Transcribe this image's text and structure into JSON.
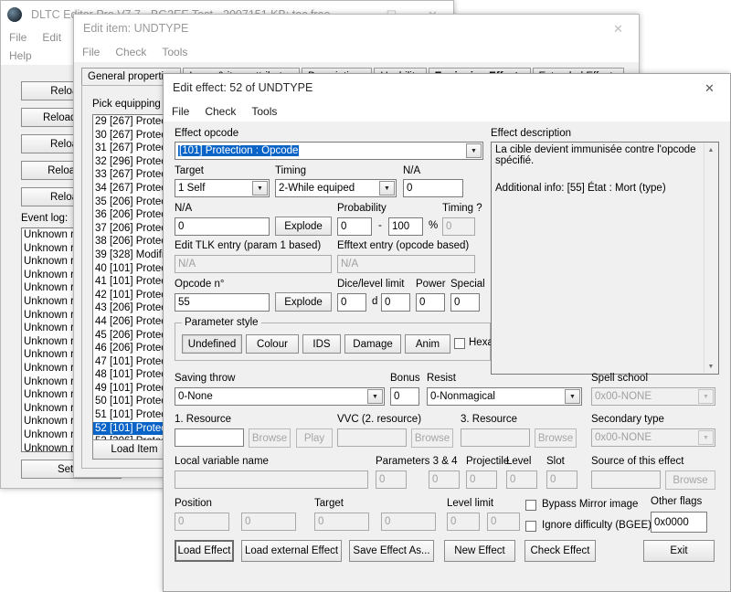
{
  "main_window": {
    "title": "DLTC Editor Pro V7.7 - BG2EE Test - 2007151 KB: toc free",
    "minimize": "—",
    "maximize": "☐",
    "close": "✕",
    "menus": [
      "File",
      "Edit",
      "S",
      "Help"
    ],
    "buttons": [
      "Reload c",
      "Reload gam",
      "Reload d",
      "Reload va",
      "Reload e"
    ],
    "event_log_label": "Event log:",
    "event_log_entries": [
      "Unknown re",
      "Unknown re",
      "Unknown re",
      "Unknown re",
      "Unknown re",
      "Unknown re",
      "Unknown re",
      "Unknown re",
      "Unknown re",
      "Unknown re",
      "Unknown re",
      "Unknown re",
      "Unknown re",
      "Unknown re",
      "Unknown re",
      "Unknown re",
      "Unknown re"
    ],
    "setup_button": "Setup"
  },
  "item_window": {
    "title": "Edit item: UNDTYPE",
    "close": "✕",
    "menus": [
      "File",
      "Check",
      "Tools"
    ],
    "tabs": [
      "General properties",
      "Icons & item attributes",
      "Descriptions",
      "Usability",
      "Equipping Effects",
      "Extended Effects"
    ],
    "active_tab": "Equipping Effects",
    "pick_label": "Pick equipping e",
    "effects": [
      {
        "text": "29 [267] Protec",
        "selected": false
      },
      {
        "text": "30 [267] Protec",
        "selected": false
      },
      {
        "text": "31 [267] Protec",
        "selected": false
      },
      {
        "text": "32 [296] Protec",
        "selected": false
      },
      {
        "text": "33 [267] Protec",
        "selected": false
      },
      {
        "text": "34 [267] Protec",
        "selected": false
      },
      {
        "text": "35 [206] Protec",
        "selected": false
      },
      {
        "text": "36 [206] Protec",
        "selected": false
      },
      {
        "text": "37 [206] Protec",
        "selected": false
      },
      {
        "text": "38 [206] Protec",
        "selected": false
      },
      {
        "text": "39 [328] Modific",
        "selected": false
      },
      {
        "text": "40 [101] Protec",
        "selected": false
      },
      {
        "text": "41 [101] Protec",
        "selected": false
      },
      {
        "text": "42 [101] Protec",
        "selected": false
      },
      {
        "text": "43 [206] Protec",
        "selected": false
      },
      {
        "text": "44 [206] Protec",
        "selected": false
      },
      {
        "text": "45 [206] Protec",
        "selected": false
      },
      {
        "text": "46 [206] Protec",
        "selected": false
      },
      {
        "text": "47 [101] Protec",
        "selected": false
      },
      {
        "text": "48 [101] Protec",
        "selected": false
      },
      {
        "text": "49 [101] Protec",
        "selected": false
      },
      {
        "text": "50 [101] Protec",
        "selected": false
      },
      {
        "text": "51 [101] Protec",
        "selected": false
      },
      {
        "text": "52 [101] Protec",
        "selected": true
      },
      {
        "text": "53 [206] Protec",
        "selected": false
      }
    ],
    "load_item_button": "Load Item"
  },
  "effect_window": {
    "title": "Edit effect: 52 of UNDTYPE",
    "close": "✕",
    "menus": [
      "File",
      "Check",
      "Tools"
    ],
    "opcode": {
      "label": "Effect opcode",
      "value": "[101] Protection : Opcode"
    },
    "target": {
      "label": "Target",
      "value": "1 Self"
    },
    "timing": {
      "label": "Timing",
      "value": "2-While equiped"
    },
    "na_top": {
      "label": "N/A",
      "value": "0"
    },
    "na_mid": {
      "label": "N/A",
      "value": "0",
      "explode": "Explode"
    },
    "probability": {
      "label": "Probability",
      "min": "0",
      "sep": "-",
      "max": "100",
      "percent": "%"
    },
    "timing_q": {
      "label": "Timing ?",
      "value": "0"
    },
    "tlk_entry": {
      "label": "Edit TLK entry (param 1 based)",
      "value": "N/A"
    },
    "efftext_entry": {
      "label": "Efftext entry (opcode based)",
      "value": "N/A"
    },
    "opcode_n": {
      "label": "Opcode n°",
      "value": "55",
      "explode": "Explode"
    },
    "dice": {
      "label": "Dice/level limit",
      "count": "0",
      "d": "d",
      "sides": "0"
    },
    "power": {
      "label": "Power",
      "value": "0"
    },
    "special": {
      "label": "Special",
      "value": "0"
    },
    "param_style": {
      "label": "Parameter style",
      "buttons": [
        "Undefined",
        "Colour",
        "IDS",
        "Damage",
        "Anim"
      ],
      "active": "Undefined",
      "hexa_label": "Hexa"
    },
    "saving_throw": {
      "label": "Saving throw",
      "value": "0-None"
    },
    "bonus": {
      "label": "Bonus",
      "value": "0"
    },
    "resist": {
      "label": "Resist",
      "value": "0-Nonmagical"
    },
    "spell_school": {
      "label": "Spell school",
      "value": "0x00-NONE"
    },
    "resource1": {
      "label": "1. Resource",
      "value": "",
      "browse": "Browse",
      "play": "Play"
    },
    "resource2": {
      "label": "VVC (2. resource)",
      "value": "",
      "browse": "Browse"
    },
    "resource3": {
      "label": "3. Resource",
      "value": "",
      "browse": "Browse"
    },
    "secondary_type": {
      "label": "Secondary type",
      "value": "0x00-NONE"
    },
    "local_var": {
      "label": "Local variable name",
      "value": ""
    },
    "params34": {
      "label": "Parameters 3 & 4",
      "p3": "0",
      "p4": "0"
    },
    "projectile": {
      "label": "Projectile",
      "value": "0"
    },
    "level": {
      "label": "Level",
      "value": "0"
    },
    "slot": {
      "label": "Slot",
      "value": "0"
    },
    "source": {
      "label": "Source of this effect",
      "value": "",
      "browse": "Browse"
    },
    "position": {
      "label": "Position",
      "x": "0",
      "y": "0"
    },
    "target2": {
      "label": "Target",
      "x": "0",
      "y": "0"
    },
    "level_limit": {
      "label": "Level limit",
      "min": "0",
      "max": "0"
    },
    "bypass_mirror": {
      "label": "Bypass Mirror image",
      "checked": false
    },
    "ignore_difficulty": {
      "label": "Ignore difficulty (BGEE)",
      "checked": false
    },
    "other_flags": {
      "label": "Other flags",
      "value": "0x0000"
    },
    "description": {
      "label": "Effect description",
      "line1": "La cible devient immunisée contre l'opcode",
      "line2": "spécifié.",
      "line3": "Additional info: [55] État : Mort (type)"
    },
    "footer_buttons": [
      "Load Effect",
      "Load external Effect",
      "Save Effect As...",
      "New Effect",
      "Check Effect",
      "Exit"
    ]
  }
}
